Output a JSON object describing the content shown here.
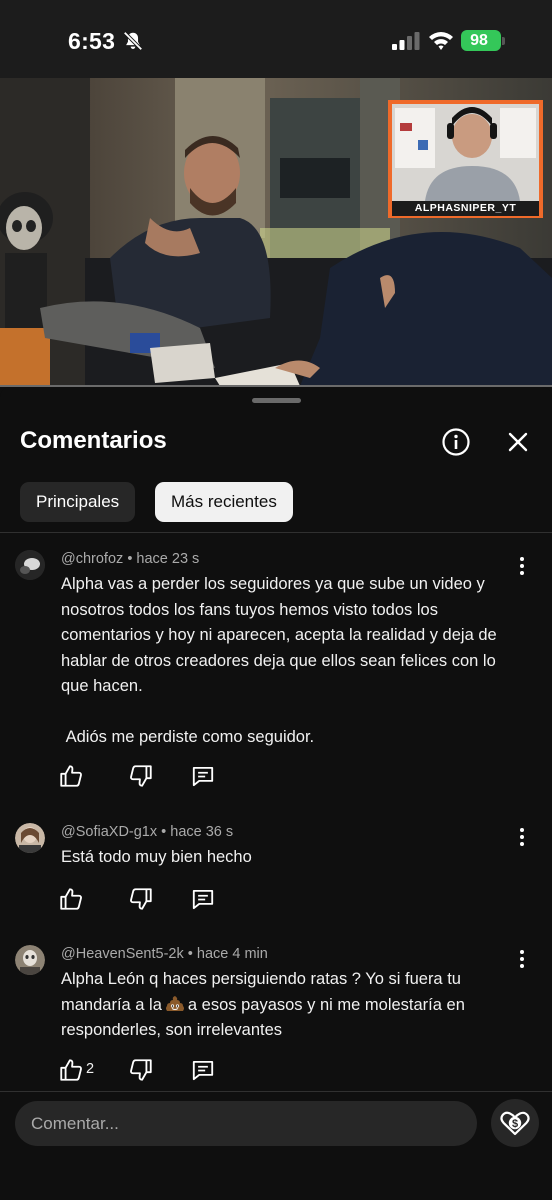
{
  "status": {
    "time": "6:53",
    "battery": "98"
  },
  "video": {
    "overlay_handle": "ALPHASNIPER_YT"
  },
  "sheet": {
    "title": "Comentarios",
    "chips": [
      "Principales",
      "Más recientes"
    ],
    "selected_chip": "Más recientes"
  },
  "comments": [
    {
      "author": "@chrofoz",
      "time": "hace 23 s",
      "text": "Alpha vas a perder los seguidores ya que sube un video y nosotros todos los fans tuyos hemos visto todos los comentarios y hoy ni aparecen, acepta la realidad y deja de hablar de otros creadores deja que ellos sean felices con lo que hacen.\n\n Adiós me perdiste como seguidor.",
      "likes": ""
    },
    {
      "author": "@SofiaXD-g1x",
      "time": "hace 36 s",
      "text": "Está todo muy bien hecho",
      "likes": ""
    },
    {
      "author": "@HeavenSent5-2k",
      "time": "hace 4 min",
      "text_before_emoji": "Alpha León q haces persiguiendo ratas ? Yo si fuera tu mandaría a la",
      "emoji": "poop-emoji",
      "text_after_emoji": "a esos payasos y ni me molestaría en responderles, son irrelevantes",
      "likes": "2"
    }
  ],
  "input": {
    "placeholder": "Comentar..."
  },
  "colors": {
    "background": "#0f0f0f",
    "chip_selected": "#f1f1f1",
    "chip": "#272727",
    "secondary_text": "#aaaaaa",
    "battery": "#34c759"
  }
}
